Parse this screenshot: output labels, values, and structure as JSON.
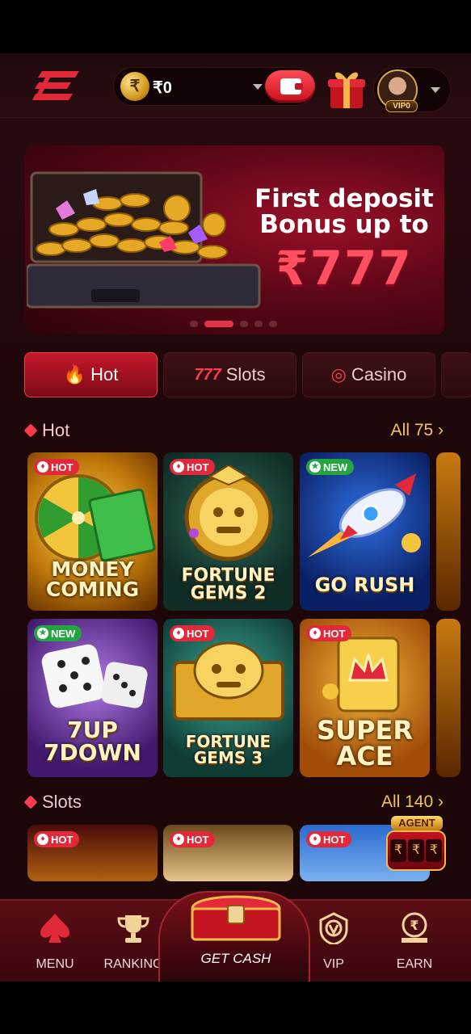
{
  "header": {
    "balance": "₹0",
    "currency_symbol": "₹",
    "vip_level": "VIP0"
  },
  "banner": {
    "title": "First deposit Bonus up to",
    "amount": "₹777",
    "slide_count": 5,
    "active_slide": 1
  },
  "tabs": [
    {
      "label": "Hot",
      "icon": "flame-icon",
      "active": true
    },
    {
      "label": "Slots",
      "icon": "777-icon",
      "active": false
    },
    {
      "label": "Casino",
      "icon": "chips-icon",
      "active": false
    }
  ],
  "sections": {
    "hot": {
      "title": "Hot",
      "all_label": "All 75",
      "games": [
        {
          "title_line1": "MONEY",
          "title_line2": "COMING",
          "badge": "HOT"
        },
        {
          "title_line1": "FORTUNE",
          "title_line2": "GEMS 2",
          "badge": "HOT"
        },
        {
          "title_line1": "GO RUSH",
          "title_line2": "",
          "badge": "NEW"
        },
        {
          "title_line1": "7UP",
          "title_line2": "7DOWN",
          "badge": "NEW"
        },
        {
          "title_line1": "FORTUNE",
          "title_line2": "GEMS 3",
          "badge": "HOT"
        },
        {
          "title_line1": "SUPER",
          "title_line2": "ACE",
          "badge": "HOT"
        }
      ]
    },
    "slots": {
      "title": "Slots",
      "all_label": "All 140",
      "badges": [
        "HOT",
        "HOT",
        "HOT"
      ]
    }
  },
  "agent_badge": "AGENT",
  "bottom_nav": [
    {
      "label": "MENU",
      "icon": "spade-icon"
    },
    {
      "label": "RANKING",
      "icon": "trophy-icon"
    },
    {
      "label": "GET CASH",
      "icon": "treasure-chest-icon"
    },
    {
      "label": "VIP",
      "icon": "vip-shield-icon"
    },
    {
      "label": "EARN",
      "icon": "rupee-earn-icon"
    }
  ],
  "colors": {
    "accent_red": "#e2293a",
    "gold": "#f4c25a",
    "background": "#1e0709"
  }
}
